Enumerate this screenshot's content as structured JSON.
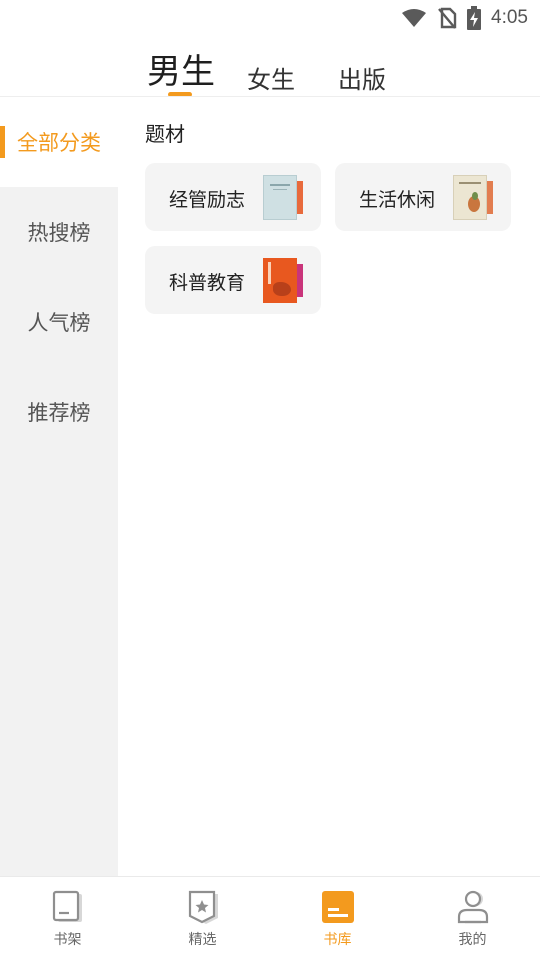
{
  "status_bar": {
    "time": "4:05",
    "icons": [
      "wifi-icon",
      "no-sim-icon",
      "battery-charging-icon"
    ]
  },
  "top_tabs": [
    {
      "label": "男生",
      "active": true
    },
    {
      "label": "女生",
      "active": false
    },
    {
      "label": "出版",
      "active": false
    }
  ],
  "sidebar": {
    "items": [
      {
        "label": "全部分类",
        "active": true
      },
      {
        "label": "热搜榜",
        "active": false
      },
      {
        "label": "人气榜",
        "active": false
      },
      {
        "label": "推荐榜",
        "active": false
      }
    ]
  },
  "content": {
    "section_title": "题材",
    "categories": [
      {
        "label": "经管励志",
        "cover_colors": [
          "#cfe0e3",
          "#e86a3c"
        ]
      },
      {
        "label": "生活休闲",
        "cover_colors": [
          "#ece6d2",
          "#e27d4f"
        ]
      },
      {
        "label": "科普教育",
        "cover_colors": [
          "#e8581f",
          "#c9347a"
        ]
      }
    ]
  },
  "bottom_nav": {
    "items": [
      {
        "label": "书架",
        "icon": "bookshelf-icon",
        "active": false
      },
      {
        "label": "精选",
        "icon": "featured-badge-icon",
        "active": false
      },
      {
        "label": "书库",
        "icon": "library-icon",
        "active": true
      },
      {
        "label": "我的",
        "icon": "profile-icon",
        "active": false
      }
    ]
  },
  "colors": {
    "accent": "#f39a1e",
    "sidebar_bg": "#f2f2f2",
    "card_bg": "#f4f4f4"
  }
}
